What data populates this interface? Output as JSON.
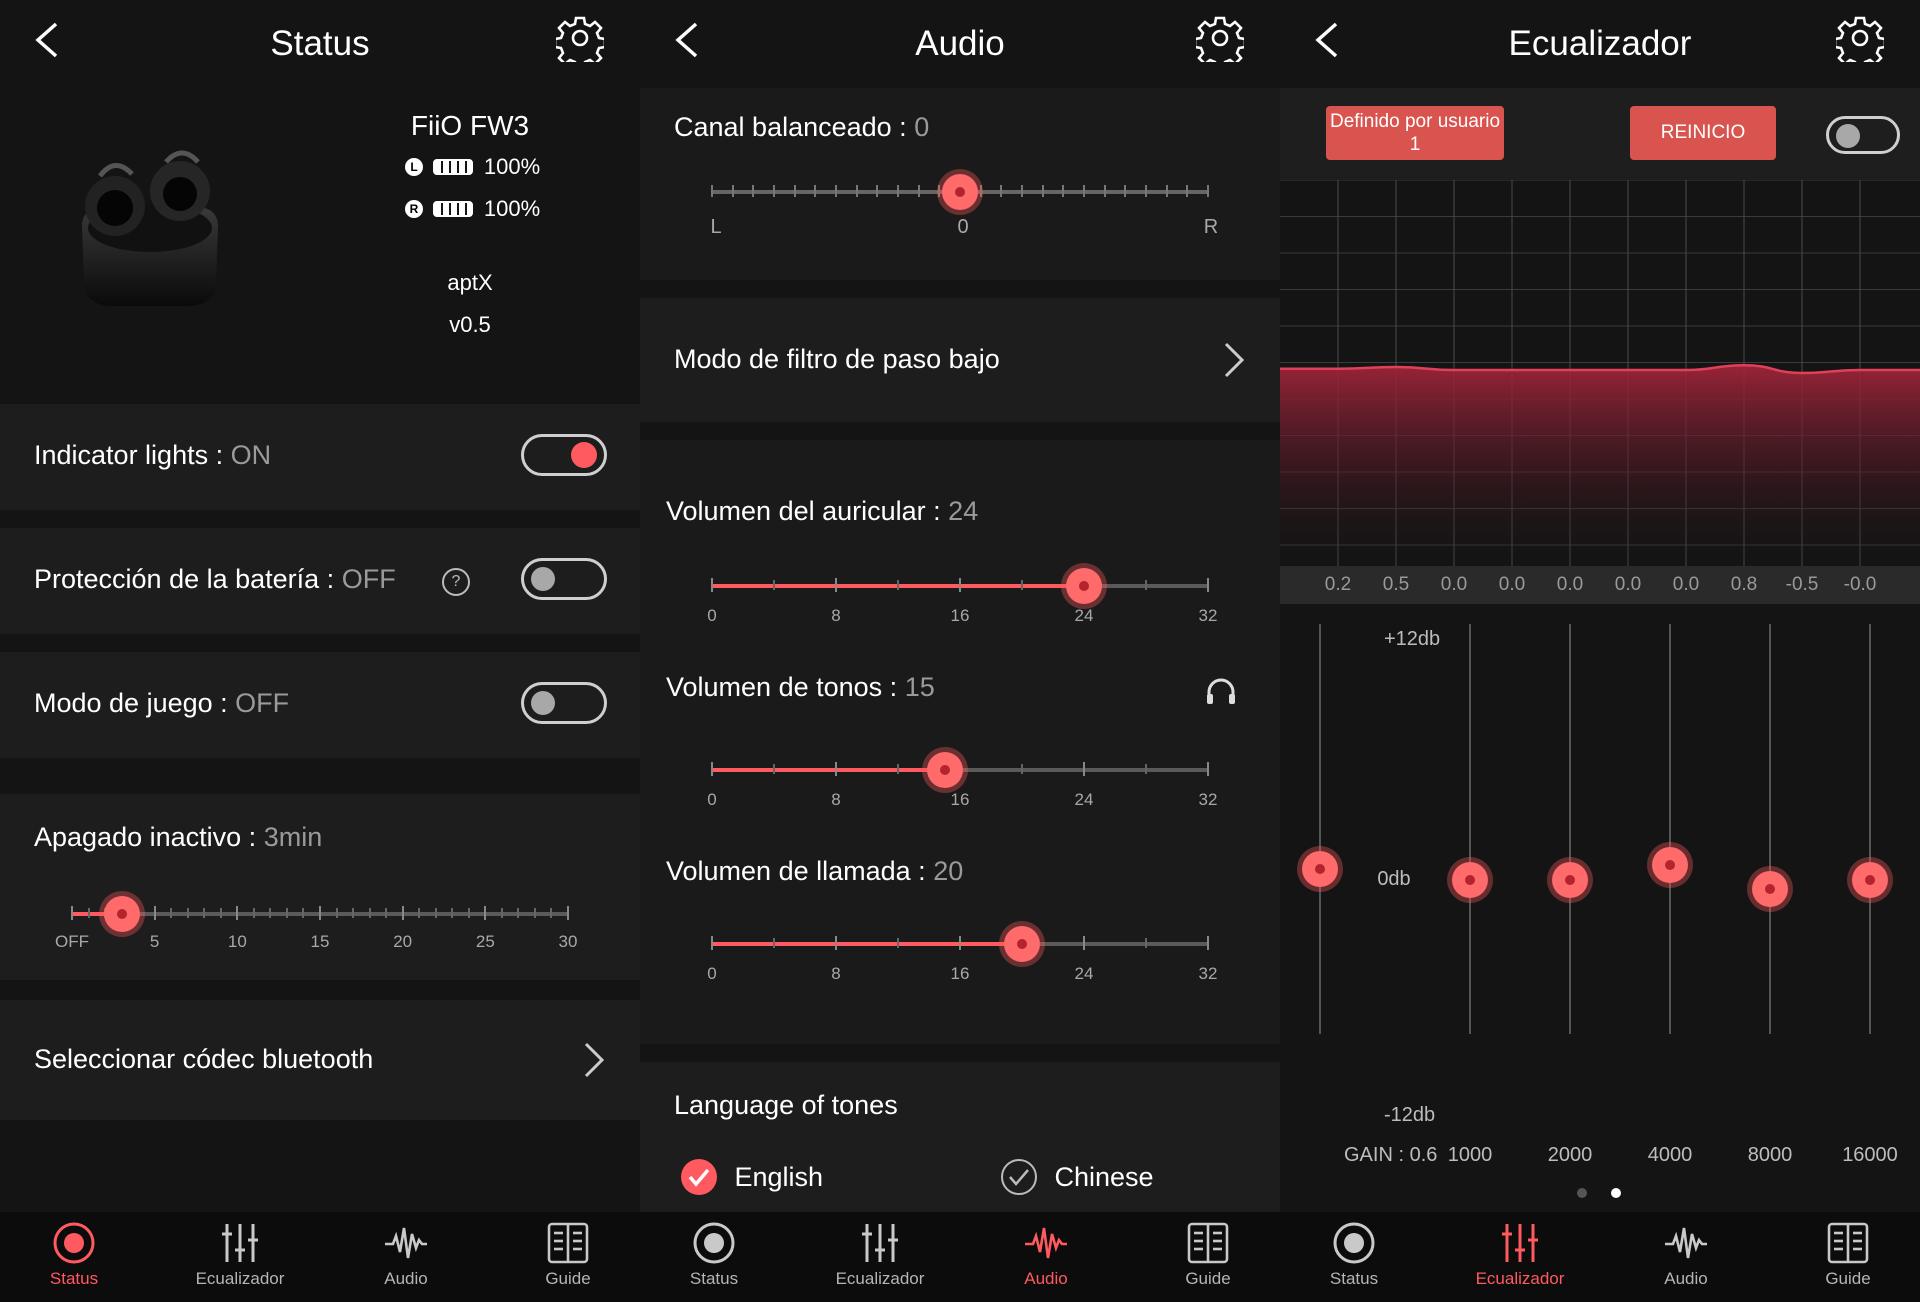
{
  "colors": {
    "accent": "#ff5a5f",
    "background": "#141414",
    "panel": "#1d1d1d",
    "muted": "#9a9a9a"
  },
  "status": {
    "title": "Status",
    "device": {
      "name": "FiiO FW3",
      "left_battery": "100%",
      "right_battery": "100%",
      "codec": "aptX",
      "version": "v0.5",
      "left_mark": "L",
      "right_mark": "R"
    },
    "indicator": {
      "label": "Indicator lights :",
      "value": "ON",
      "on": true
    },
    "battery_protection": {
      "label": "Protección de la batería :",
      "value": "OFF",
      "on": false,
      "help": "?"
    },
    "game_mode": {
      "label": "Modo de juego :",
      "value": "OFF",
      "on": false
    },
    "auto_off": {
      "label": "Apagado inactivo :",
      "value": "3min",
      "level": 3,
      "max": 30,
      "ticks": [
        "OFF",
        "5",
        "10",
        "15",
        "20",
        "25",
        "30"
      ]
    },
    "codec_select": {
      "label": "Seleccionar códec bluetooth"
    }
  },
  "audio": {
    "title": "Audio",
    "balance": {
      "label": "Canal balanceado :",
      "value": "0",
      "left": "L",
      "center": "0",
      "right": "R"
    },
    "lowpass": {
      "label": "Modo de filtro de paso bajo"
    },
    "headphone_volume": {
      "label": "Volumen del auricular :",
      "value": "24",
      "level": 24,
      "max": 32,
      "ticks": [
        "0",
        "8",
        "16",
        "24",
        "32"
      ]
    },
    "tone_volume": {
      "label": "Volumen de tonos :",
      "value": "15",
      "level": 15,
      "max": 32,
      "ticks": [
        "0",
        "8",
        "16",
        "24",
        "32"
      ]
    },
    "call_volume": {
      "label": "Volumen de llamada :",
      "value": "20",
      "level": 20,
      "max": 32,
      "ticks": [
        "0",
        "8",
        "16",
        "24",
        "32"
      ]
    },
    "language": {
      "label": "Language of tones",
      "options": [
        "English",
        "Chinese"
      ],
      "selected": "English"
    }
  },
  "eq": {
    "title": "Ecualizador",
    "preset_label": "Definido por usuario 1",
    "reset_label": "REINICIO",
    "enabled": false,
    "gains": [
      "0.2",
      "0.5",
      "0.0",
      "0.0",
      "0.0",
      "0.0",
      "0.0",
      "0.8",
      "-0.5",
      "-0.0"
    ],
    "scale_top": "+12db",
    "scale_mid": "0db",
    "scale_bottom": "-12db",
    "gain_label": "GAIN : 0.6",
    "bands": [
      "1000",
      "2000",
      "4000",
      "8000",
      "16000"
    ],
    "band_gains": [
      0.6,
      0.0,
      0.0,
      0.8,
      -0.5,
      0.0
    ],
    "page_dots": 2,
    "active_page": 2
  },
  "tabs": [
    {
      "label": "Status",
      "icon": "status-icon"
    },
    {
      "label": "Ecualizador",
      "icon": "equalizer-icon"
    },
    {
      "label": "Audio",
      "icon": "waveform-icon"
    },
    {
      "label": "Guide",
      "icon": "guide-book-icon"
    }
  ]
}
